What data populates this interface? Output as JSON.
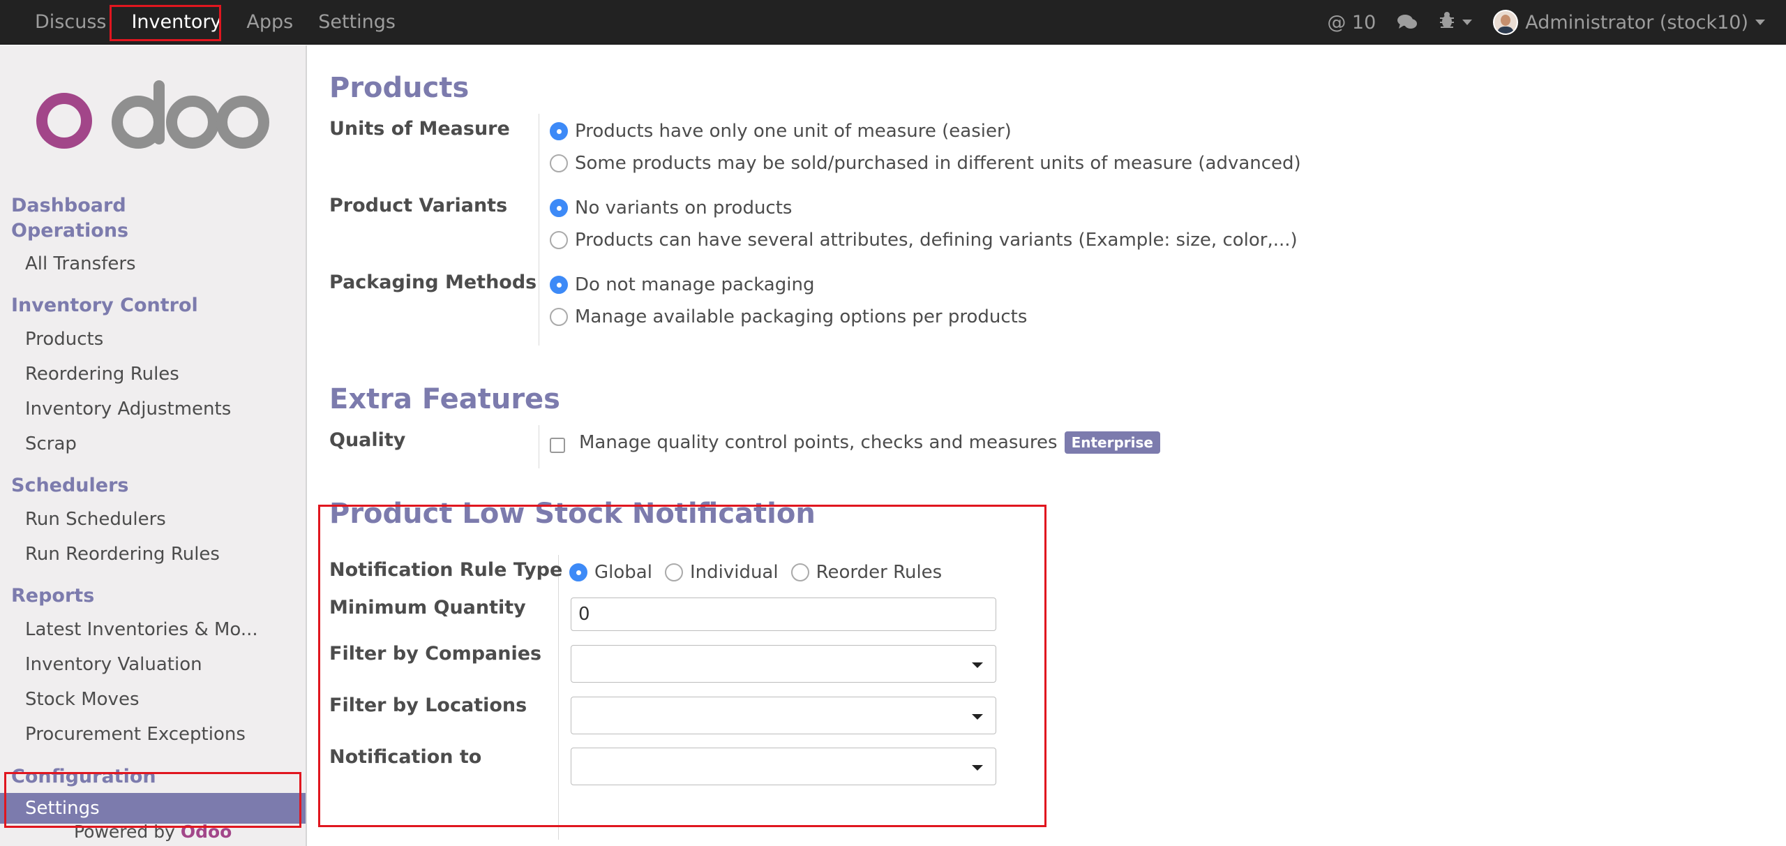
{
  "topbar": {
    "menu": [
      "Discuss",
      "Inventory",
      "Apps",
      "Settings"
    ],
    "mentions": "@ 10",
    "user": "Administrator (stock10)"
  },
  "sidebar": {
    "logo_text": "odoo",
    "dashboard": "Dashboard",
    "operations": "Operations",
    "all_transfers": "All Transfers",
    "inventory_control": "Inventory Control",
    "products": "Products",
    "reordering_rules": "Reordering Rules",
    "inventory_adjustments": "Inventory Adjustments",
    "scrap": "Scrap",
    "schedulers": "Schedulers",
    "run_schedulers": "Run Schedulers",
    "run_reordering_rules": "Run Reordering Rules",
    "reports": "Reports",
    "latest_inventories": "Latest Inventories & Mo...",
    "inventory_valuation": "Inventory Valuation",
    "stock_moves": "Stock Moves",
    "procurement_exceptions": "Procurement Exceptions",
    "configuration": "Configuration",
    "settings": "Settings",
    "powered_by": "Powered by",
    "powered_brand": "Odoo"
  },
  "products_section": {
    "title": "Products",
    "uom_label": "Units of Measure",
    "uom_opt1": "Products have only one unit of measure (easier)",
    "uom_opt2": "Some products may be sold/purchased in different units of measure (advanced)",
    "variants_label": "Product Variants",
    "variants_opt1": "No variants on products",
    "variants_opt2": "Products can have several attributes, defining variants (Example: size, color,...)",
    "packaging_label": "Packaging Methods",
    "packaging_opt1": "Do not manage packaging",
    "packaging_opt2": "Manage available packaging options per products"
  },
  "extra_section": {
    "title": "Extra Features",
    "quality_label": "Quality",
    "quality_opt": "Manage quality control points, checks and measures",
    "enterprise_badge": "Enterprise"
  },
  "low_stock_section": {
    "title": "Product Low Stock Notification",
    "rule_type_label": "Notification Rule Type",
    "rule_global": "Global",
    "rule_individual": "Individual",
    "rule_reorder": "Reorder Rules",
    "min_qty_label": "Minimum Quantity",
    "min_qty_value": "0",
    "companies_label": "Filter by Companies",
    "locations_label": "Filter by Locations",
    "notify_label": "Notification to"
  },
  "colors": {
    "accent": "#7c7bad",
    "radio_selected": "#3d8af7",
    "topbar": "#222222",
    "annotation": "#e0161f",
    "brand": "#a24689"
  }
}
